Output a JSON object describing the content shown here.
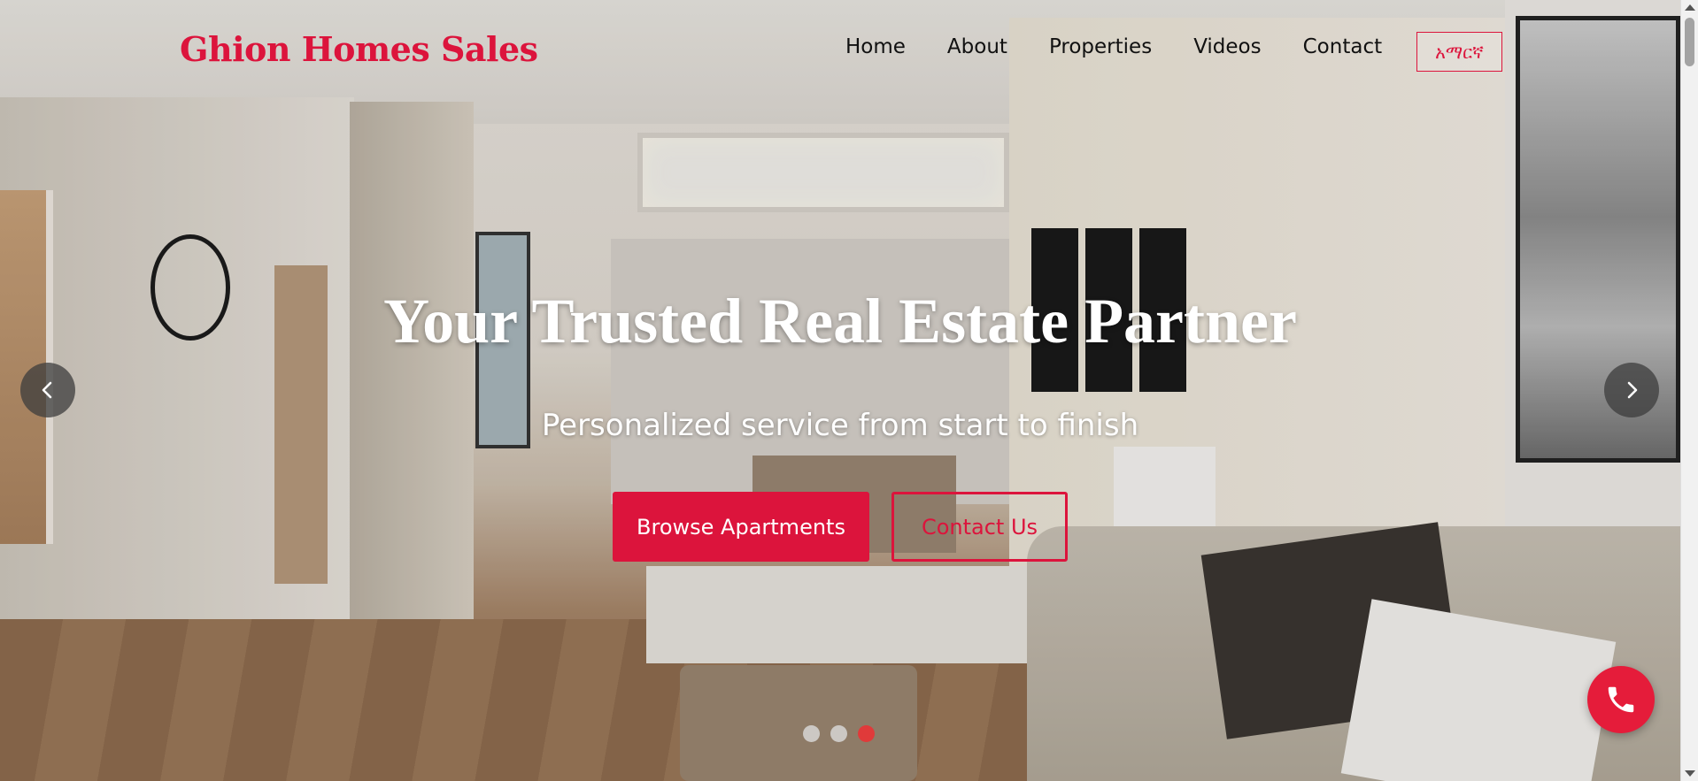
{
  "brand": {
    "name": "Ghion Homes Sales"
  },
  "nav": {
    "items": [
      {
        "label": "Home"
      },
      {
        "label": "About"
      },
      {
        "label": "Properties"
      },
      {
        "label": "Videos"
      },
      {
        "label": "Contact"
      }
    ],
    "language_button": "አማርኛ"
  },
  "hero": {
    "title": "Your Trusted Real Estate Partner",
    "subtitle": "Personalized service from start to finish",
    "primary_cta": "Browse Apartments",
    "secondary_cta": "Contact Us"
  },
  "carousel": {
    "slide_count": 3,
    "active_slide": 3,
    "prev_icon": "chevron-left-icon",
    "next_icon": "chevron-right-icon"
  },
  "floating_action": {
    "icon": "phone-icon"
  },
  "colors": {
    "brand": "#dc143c",
    "call_button": "#e51c3a",
    "active_dot": "#e03a3a"
  }
}
